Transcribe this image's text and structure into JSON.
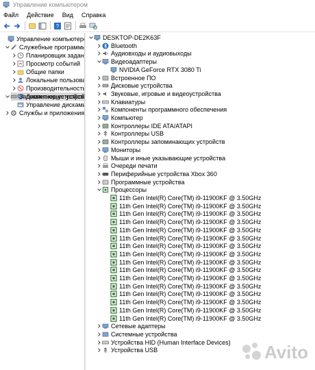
{
  "window": {
    "title": "Управление компьютером"
  },
  "menu": [
    "Файл",
    "Действие",
    "Вид",
    "Справка"
  ],
  "left_tree": {
    "root": "Управление компьютером (л",
    "service_programs": "Служебные программы",
    "service_items": [
      "Планировщик заданий",
      "Просмотр событий",
      "Общие папки",
      "Локальные пользовате",
      "Производительность",
      "Диспетчер устройств"
    ],
    "storage": "Запоминающие устройст",
    "storage_items": [
      "Управление дисками"
    ],
    "services_apps": "Службы и приложения"
  },
  "device_tree": {
    "computer": "DESKTOP-DE2K63F",
    "categories_top": [
      "Bluetooth",
      "Аудиовходы и аудиовыходы",
      "Видеоадаптеры"
    ],
    "gpu": "NVIDIA GeForce RTX 3080 Ti",
    "categories_mid": [
      "Встроенное ПО",
      "Дисковые устройства",
      "Звуковые, игровые и видеоустройства",
      "Клавиатуры",
      "Компоненты программного обеспечения",
      "Компьютер",
      "Контроллеры IDE ATA/ATAPI",
      "Контроллеры USB",
      "Контроллеры запоминающих устройств",
      "Мониторы",
      "Мыши и иные указывающие устройства",
      "Очереди печати",
      "Периферийные устройства Xbox 360",
      "Программные устройства",
      "Процессоры"
    ],
    "processors": [
      "11th Gen Intel(R) Core(TM) i9-11900KF @ 3.50GHz",
      "11th Gen Intel(R) Core(TM) i9-11900KF @ 3.50GHz",
      "11th Gen Intel(R) Core(TM) i9-11900KF @ 3.50GHz",
      "11th Gen Intel(R) Core(TM) i9-11900KF @ 3.50GHz",
      "11th Gen Intel(R) Core(TM) i9-11900KF @ 3.50GHz",
      "11th Gen Intel(R) Core(TM) i9-11900KF @ 3.50GHz",
      "11th Gen Intel(R) Core(TM) i9-11900KF @ 3.50GHz",
      "11th Gen Intel(R) Core(TM) i9-11900KF @ 3.50GHz",
      "11th Gen Intel(R) Core(TM) i9-11900KF @ 3.50GHz",
      "11th Gen Intel(R) Core(TM) i9-11900KF @ 3.50GHz",
      "11th Gen Intel(R) Core(TM) i9-11900KF @ 3.50GHz",
      "11th Gen Intel(R) Core(TM) i9-11900KF @ 3.50GHz",
      "11th Gen Intel(R) Core(TM) i9-11900KF @ 3.50GHz",
      "11th Gen Intel(R) Core(TM) i9-11900KF @ 3.50GHz",
      "11th Gen Intel(R) Core(TM) i9-11900KF @ 3.50GHz",
      "11th Gen Intel(R) Core(TM) i9-11900KF @ 3.50GHz"
    ],
    "categories_bottom": [
      "Сетевые адаптеры",
      "Системные устройства",
      "Устройства HID (Human Interface Devices)",
      "Устройства USB"
    ]
  },
  "watermark": {
    "text": "Avito"
  },
  "colors": {
    "cpu_icon": "#3e7a3e",
    "selection": "#d9d9d9",
    "title_text": "#8a8a8a"
  }
}
